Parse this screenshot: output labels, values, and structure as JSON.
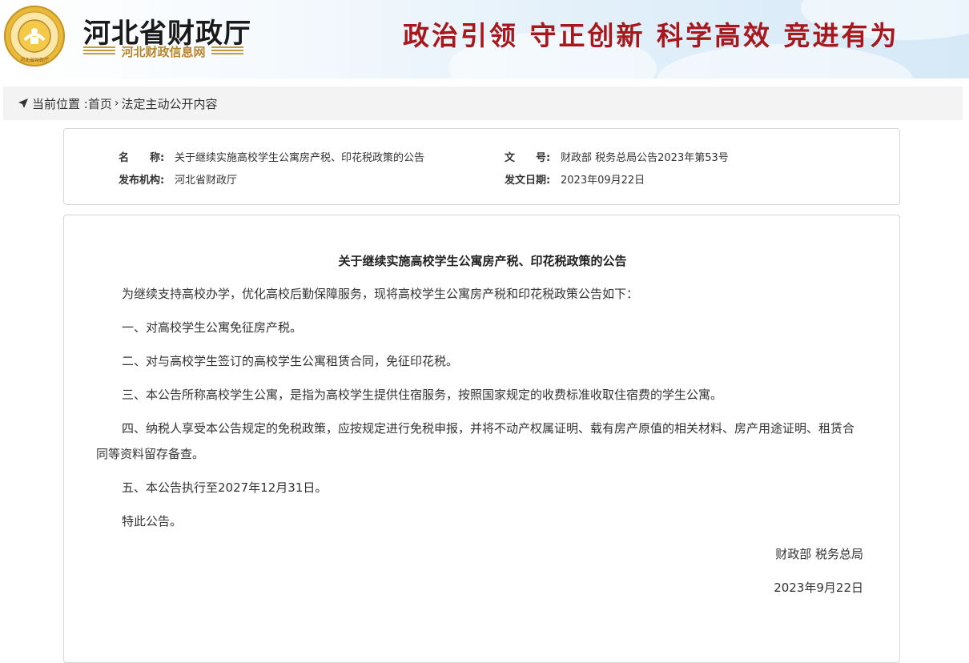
{
  "header": {
    "site_title": "河北省财政厅",
    "site_subtitle": "河北财政信息网",
    "slogan": "政治引领  守正创新  科学高效  竞进有为",
    "emblem_text": "河北省财政厅"
  },
  "breadcrumb": {
    "label": "当前位置 :",
    "home": "首页",
    "separator": "›",
    "current": "法定主动公开内容"
  },
  "meta": {
    "name_key": "名　　称:",
    "name_value": "关于继续实施高校学生公寓房产税、印花税政策的公告",
    "docno_key": "文　　号:",
    "docno_value": "财政部 税务总局公告2023年第53号",
    "org_key": "发布机构:",
    "org_value": "河北省财政厅",
    "date_key": "发文日期:",
    "date_value": "2023年09月22日"
  },
  "document": {
    "title": "关于继续实施高校学生公寓房产税、印花税政策的公告",
    "paragraphs": [
      "为继续支持高校办学，优化高校后勤保障服务，现将高校学生公寓房产税和印花税政策公告如下：",
      "一、对高校学生公寓免征房产税。",
      "二、对与高校学生签订的高校学生公寓租赁合同，免征印花税。",
      "三、本公告所称高校学生公寓，是指为高校学生提供住宿服务，按照国家规定的收费标准收取住宿费的学生公寓。",
      "四、纳税人享受本公告规定的免税政策，应按规定进行免税申报，并将不动产权属证明、载有房产原值的相关材料、房产用途证明、租赁合同等资料留存备查。",
      "五、本公告执行至2027年12月31日。",
      "特此公告。"
    ],
    "signature": "财政部  税务总局",
    "sign_date": "2023年9月22日"
  },
  "colors": {
    "slogan": "#a6181c",
    "subtitle": "#b8862b",
    "border": "#d6d6d6"
  }
}
